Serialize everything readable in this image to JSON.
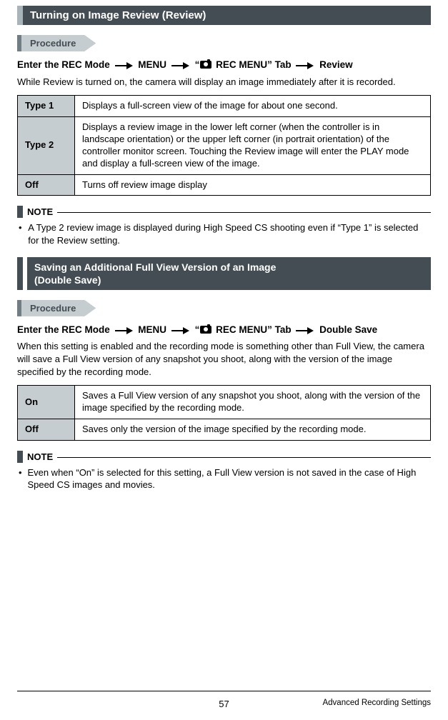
{
  "section1": {
    "title": "Turning on Image Review (Review)",
    "procedure_label": "Procedure",
    "path": {
      "p1": "Enter the REC Mode",
      "p2": "MENU",
      "p3a": "“",
      "p3b": " REC MENU” Tab",
      "p4": "Review"
    },
    "desc": "While Review is turned on, the camera will display an image immediately after it is recorded.",
    "table": [
      {
        "k": "Type 1",
        "v": "Displays a full-screen view of the image for about one second."
      },
      {
        "k": "Type 2",
        "v": "Displays a review image in the lower left corner (when the controller is in landscape orientation) or the upper left corner (in portrait orientation) of the controller monitor screen. Touching the Review image will enter the PLAY mode and display a full-screen view of the image."
      },
      {
        "k": "Off",
        "v": "Turns off review image display"
      }
    ],
    "note_label": "NOTE",
    "notes": [
      "A Type 2 review image is displayed during High Speed CS shooting even if “Type 1” is selected for the Review setting."
    ]
  },
  "section2": {
    "title_line1": "Saving an Additional Full View Version of an Image",
    "title_line2": "(Double Save)",
    "procedure_label": "Procedure",
    "path": {
      "p1": "Enter the REC Mode",
      "p2": "MENU",
      "p3a": "“",
      "p3b": " REC MENU” Tab",
      "p4": "Double Save"
    },
    "desc": "When this setting is enabled and the recording mode is something other than Full View, the camera will save a Full View version of any snapshot you shoot, along with the version of the image specified by the recording mode.",
    "table": [
      {
        "k": "On",
        "v": "Saves a Full View version of any snapshot you shoot, along with the version of the image specified by the recording mode."
      },
      {
        "k": "Off",
        "v": "Saves only the version of the image specified by the recording mode."
      }
    ],
    "note_label": "NOTE",
    "notes": [
      "Even when “On” is selected for this setting, a Full View version is not saved in the case of High Speed CS images and movies."
    ]
  },
  "footer": {
    "page": "57",
    "right": "Advanced Recording Settings"
  }
}
